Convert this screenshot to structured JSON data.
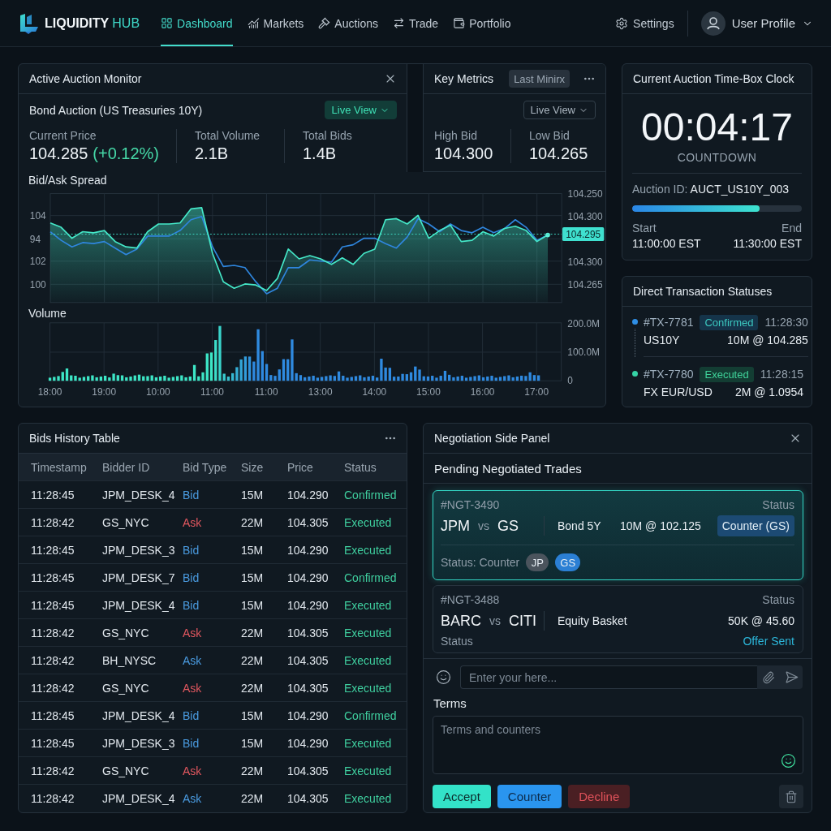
{
  "nav": {
    "logo": {
      "name": "LIQUIDITY",
      "suffix": "HUB"
    },
    "items": [
      {
        "label": "Dashboard",
        "selected": true
      },
      {
        "label": "Markets",
        "selected": false
      },
      {
        "label": "Auctions",
        "selected": false
      },
      {
        "label": "Trade",
        "selected": false
      },
      {
        "label": "Portfolio",
        "selected": false
      }
    ],
    "settings": "Settings",
    "user": "User Profile"
  },
  "auction_monitor": {
    "title": "Active Auction Monitor",
    "subtitle": "Bond Auction (US Treasuries 10Y)",
    "view_button": "Live View",
    "stats": [
      {
        "label": "Current Price",
        "value": "104.285",
        "change": "(+0.12%)"
      },
      {
        "label": "Total Volume",
        "value": "2.1B"
      },
      {
        "label": "Total Bids",
        "value": "1.4B"
      }
    ],
    "spread_chart": {
      "chart_data": {
        "type": "area",
        "title": "Bid/Ask Spread",
        "grid": true,
        "categories": [
          null,
          null,
          null,
          null,
          null,
          null,
          null,
          null,
          null,
          null,
          null,
          null,
          null,
          null,
          null,
          null,
          null,
          null,
          null,
          null,
          null,
          null,
          null,
          null,
          null,
          null,
          null,
          null,
          null,
          null,
          null,
          null,
          null,
          null,
          null,
          null,
          null,
          null,
          null,
          null,
          null,
          null,
          null,
          null,
          null,
          null,
          null
        ],
        "series": [
          {
            "color": "#45e8c8",
            "values": [
              103.57,
              103.32,
              102.68,
              103.06,
              103.0,
              103.13,
              102.49,
              102.18,
              102.11,
              103.06,
              103.51,
              103.51,
              103.57,
              104.39,
              104.46,
              101.8,
              100.15,
              99.77,
              100.02,
              99.96,
              99.64,
              100.34,
              102.05,
              101.48,
              101.67,
              101.48,
              101.16,
              101.54,
              101.16,
              101.8,
              102.05,
              103.76,
              103.82,
              103.51,
              104.01,
              102.68,
              103.13,
              103.44,
              102.49,
              102.56,
              103.06,
              102.81,
              103.25,
              103.38,
              103.13,
              102.49,
              102.87
            ]
          },
          {
            "type": "line",
            "color": "#2f86de",
            "values": [
              103.06,
              102.56,
              102.18,
              102.43,
              102.37,
              102.49,
              102.11,
              101.73,
              102.05,
              102.81,
              102.81,
              102.81,
              103.13,
              103.76,
              103.95,
              102.18,
              101.04,
              101.1,
              100.97,
              100.15,
              99.45,
              99.77,
              100.97,
              100.97,
              101.42,
              101.35,
              101.29,
              102.18,
              102.3,
              102.68,
              102.68,
              102.37,
              102.11,
              102.75,
              103.82,
              103.51,
              103.06,
              103.51,
              103.13,
              103.0,
              103.32,
              103.0,
              103.25,
              103.76,
              103.32,
              102.56,
              102.87
            ]
          }
        ],
        "ylim": [
          98.94,
          105.28
        ],
        "yticks": [
          104,
          100
        ]
      },
      "inner_axis_labels": [
        "94",
        "102"
      ],
      "right_labels": [
        {
          "text": "104.250",
          "highlighted": false
        },
        {
          "text": "104.300",
          "highlighted": false
        },
        {
          "text": "104.295",
          "highlighted": true
        },
        {
          "text": "104.300",
          "highlighted": false
        },
        {
          "text": "104.265",
          "highlighted": false
        }
      ]
    },
    "volume_chart": {
      "title": "Volume",
      "y_labels": [
        "200.0M",
        "100.0M",
        "0"
      ],
      "x_labels": [
        "18:00",
        "19:00",
        "10:00",
        "11:00",
        "11:00",
        "13:00",
        "14:00",
        "15:00",
        "16:00",
        "17:00"
      ]
    }
  },
  "key_metrics": {
    "title": "Key Metrics",
    "range_button": "Last Minirx",
    "view_button": "Live View",
    "metrics": [
      {
        "label": "High Bid",
        "value": "104.300"
      },
      {
        "label": "Low Bid",
        "value": "104.265"
      }
    ]
  },
  "clock": {
    "title": "Current Auction Time-Box Clock",
    "time": "00:04:17",
    "caption": "COUNTDOWN",
    "auction_id_label": "Auction ID:",
    "auction_id": "AUCT_US10Y_003",
    "level": 0.75,
    "start_label": "Start",
    "start_time": "11:00:00 EST",
    "end_label": "End",
    "end_time": "11:30:00 EST"
  },
  "transactions": {
    "title": "Direct Transaction Statuses",
    "items": [
      {
        "id": "#TX-7781",
        "status": "Confirmed",
        "kind": "confirmed",
        "time": "11:28:30",
        "instrument": "US10Y",
        "amount": "10M @ 104.285",
        "color": "#2f8fe6"
      },
      {
        "id": "#TX-7780",
        "status": "Executed",
        "kind": "executed",
        "time": "11:28:15",
        "instrument": "FX EUR/USD",
        "amount": "2M @ 1.0954",
        "color": "#35d3a6"
      }
    ]
  },
  "bids_table": {
    "title": "Bids History Table",
    "columns": [
      "Timestamp",
      "Bidder ID",
      "Bid Type",
      "Size",
      "Price",
      "Status"
    ],
    "rows": [
      {
        "timestamp": "11:28:45",
        "bidder_id": "JPM_DESK_4",
        "bid_type": {
          "text": "Bid",
          "color": "#4a9be0"
        },
        "size": "15M",
        "price": "104.290",
        "status": "Confirmed"
      },
      {
        "timestamp": "11:28:42",
        "bidder_id": "GS_NYC",
        "bid_type": {
          "text": "Ask",
          "color": "#e0575f"
        },
        "size": "22M",
        "price": "104.305",
        "status": "Executed"
      },
      {
        "timestamp": "11:28:45",
        "bidder_id": "JPM_DESK_3",
        "bid_type": {
          "text": "Bid",
          "color": "#4a9be0"
        },
        "size": "15M",
        "price": "104.290",
        "status": "Executed"
      },
      {
        "timestamp": "11:28:45",
        "bidder_id": "JPM_DESK_7",
        "bid_type": {
          "text": "Bid",
          "color": "#4a9be0"
        },
        "size": "15M",
        "price": "104.290",
        "status": "Confirmed"
      },
      {
        "timestamp": "11:28:45",
        "bidder_id": "JPM_DESK_4",
        "bid_type": {
          "text": "Bid",
          "color": "#4a9be0"
        },
        "size": "15M",
        "price": "104.290",
        "status": "Executed"
      },
      {
        "timestamp": "11:28:42",
        "bidder_id": "GS_NYC",
        "bid_type": {
          "text": "Ask",
          "color": "#e0575f"
        },
        "size": "22M",
        "price": "104.305",
        "status": "Executed"
      },
      {
        "timestamp": "11:28:42",
        "bidder_id": "BH_NYSC",
        "bid_type": {
          "text": "Ask",
          "color": "#4a9be0"
        },
        "size": "22M",
        "price": "104.305",
        "status": "Executed"
      },
      {
        "timestamp": "11:28:42",
        "bidder_id": "GS_NYC",
        "bid_type": {
          "text": "Ask",
          "color": "#e0575f"
        },
        "size": "22M",
        "price": "104.305",
        "status": "Executed"
      },
      {
        "timestamp": "11:28:45",
        "bidder_id": "JPM_DESK_4",
        "bid_type": {
          "text": "Bid",
          "color": "#4a9be0"
        },
        "size": "15M",
        "price": "104.290",
        "status": "Confirmed"
      },
      {
        "timestamp": "11:28:45",
        "bidder_id": "JPM_DESK_3",
        "bid_type": {
          "text": "Bid",
          "color": "#4a9be0"
        },
        "size": "15M",
        "price": "104.290",
        "status": "Executed"
      },
      {
        "timestamp": "11:28:42",
        "bidder_id": "GS_NYC",
        "bid_type": {
          "text": "Ask",
          "color": "#e0575f"
        },
        "size": "22M",
        "price": "104.305",
        "status": "Executed"
      },
      {
        "timestamp": "11:28:42",
        "bidder_id": "JPM_DESK_4",
        "bid_type": {
          "text": "Ask",
          "color": "#4a9be0"
        },
        "size": "22M",
        "price": "104.305",
        "status": "Executed"
      }
    ]
  },
  "negotiation": {
    "title": "Negotiation Side Panel",
    "subtitle": "Pending Negotiated Trades",
    "trades": [
      {
        "kind": "counter",
        "selected": true,
        "id": "#NGT-3490",
        "status_label": "Status",
        "party_a": "JPM",
        "vs": "vs",
        "party_b": "GS",
        "instrument": "Bond 5Y",
        "terms": "10M @ 102.125",
        "status_badge": "Counter (GS)",
        "footer_label": "Status: Counter",
        "chips": [
          {
            "text": "JP",
            "color": "#4b545d"
          },
          {
            "text": "GS",
            "color": "#2b7fd4"
          }
        ]
      },
      {
        "kind": "offer",
        "selected": false,
        "id": "#NGT-3488",
        "status_label": "Status",
        "party_a": "BARC",
        "vs": "vs",
        "party_b": "CITI",
        "instrument": "Equity Basket",
        "terms": "50K @ 45.60",
        "footer_label": "Status",
        "status_text": "Offer Sent"
      }
    ],
    "composer": {
      "placeholder": "Enter your here..."
    },
    "terms_label": "Terms",
    "terms_field": {
      "placeholder": "Terms and counters"
    },
    "actions": [
      {
        "label": "Accept",
        "kind": "accept"
      },
      {
        "label": "Counter",
        "kind": "counter"
      },
      {
        "label": "Decline",
        "kind": "decline"
      }
    ]
  }
}
